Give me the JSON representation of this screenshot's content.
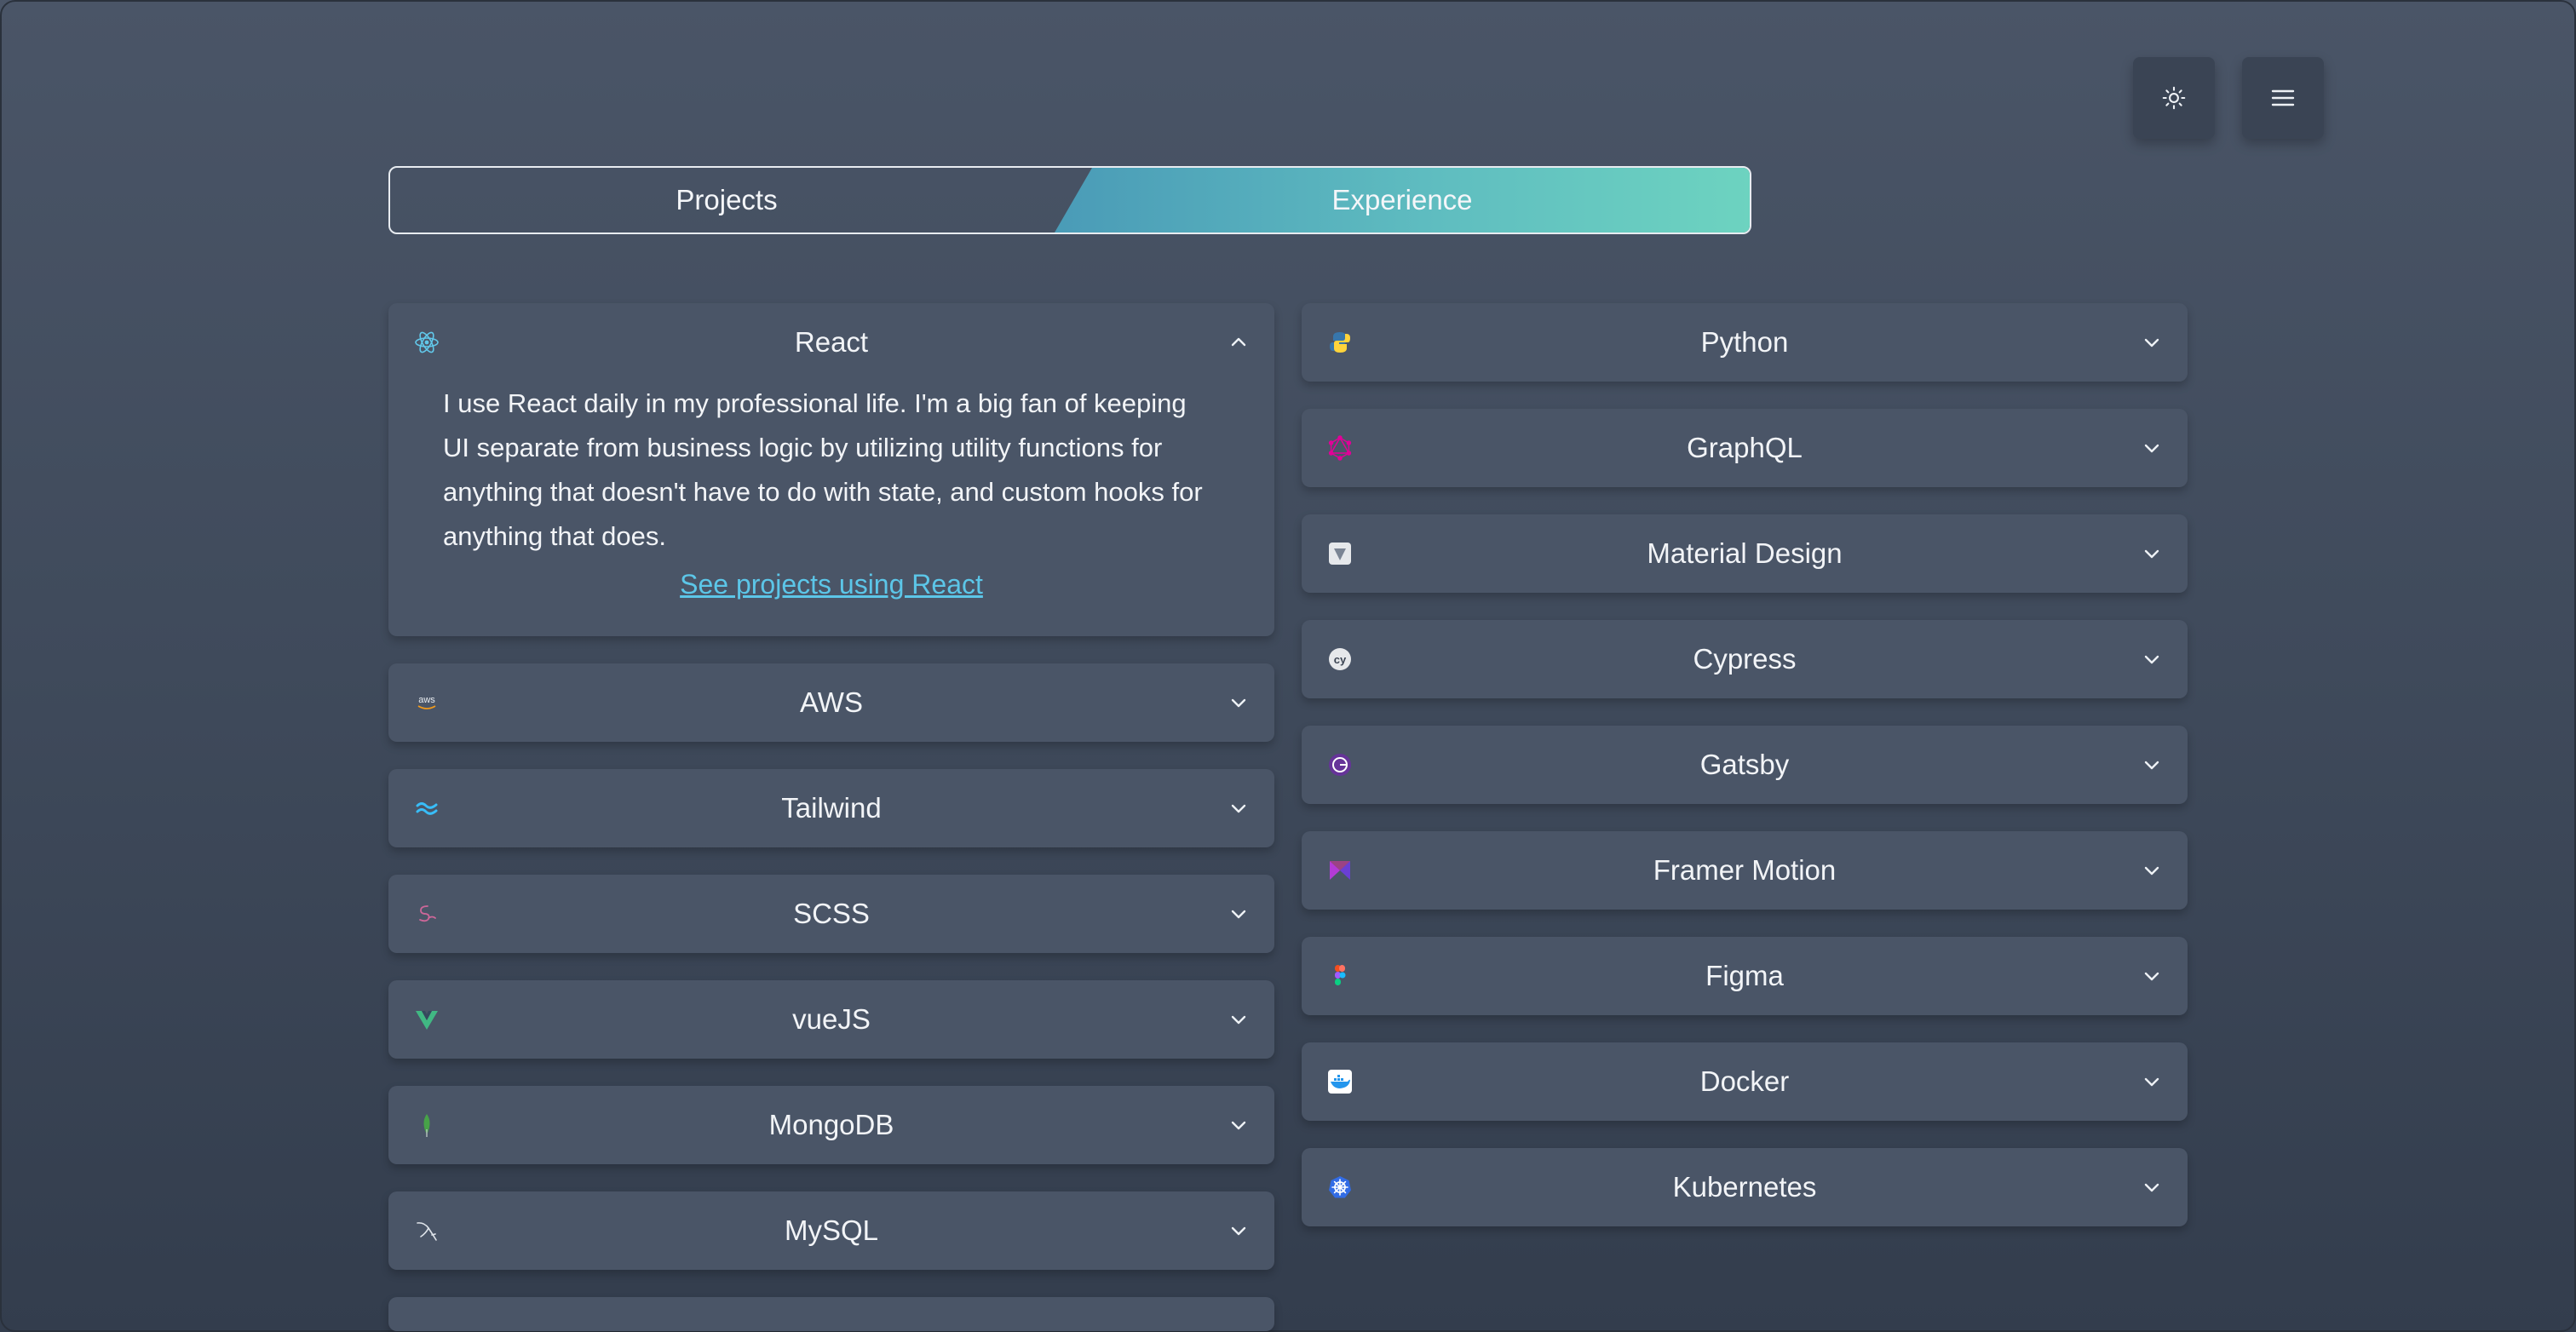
{
  "header": {
    "theme_toggle_icon": "sun-icon",
    "menu_icon": "hamburger-menu-icon"
  },
  "tabs": [
    {
      "label": "Projects",
      "active": false
    },
    {
      "label": "Experience",
      "active": true
    }
  ],
  "left_column": [
    {
      "title": "React",
      "icon": "react-icon",
      "expanded": true,
      "description": "I use React daily in my professional life. I'm a big fan of keeping UI separate from business logic by utilizing utility functions for anything that doesn't have to do with state, and custom hooks for anything that does.",
      "link": "See projects using React"
    },
    {
      "title": "AWS",
      "icon": "aws-icon",
      "expanded": false
    },
    {
      "title": "Tailwind",
      "icon": "tailwind-icon",
      "expanded": false
    },
    {
      "title": "SCSS",
      "icon": "sass-icon",
      "expanded": false
    },
    {
      "title": "vueJS",
      "icon": "vue-icon",
      "expanded": false
    },
    {
      "title": "MongoDB",
      "icon": "mongodb-icon",
      "expanded": false
    },
    {
      "title": "MySQL",
      "icon": "mysql-icon",
      "expanded": false
    }
  ],
  "right_column": [
    {
      "title": "Python",
      "icon": "python-icon",
      "expanded": false
    },
    {
      "title": "GraphQL",
      "icon": "graphql-icon",
      "expanded": false
    },
    {
      "title": "Material Design",
      "icon": "material-design-icon",
      "expanded": false
    },
    {
      "title": "Cypress",
      "icon": "cypress-icon",
      "expanded": false
    },
    {
      "title": "Gatsby",
      "icon": "gatsby-icon",
      "expanded": false
    },
    {
      "title": "Framer Motion",
      "icon": "framer-motion-icon",
      "expanded": false
    },
    {
      "title": "Figma",
      "icon": "figma-icon",
      "expanded": false
    },
    {
      "title": "Docker",
      "icon": "docker-icon",
      "expanded": false
    },
    {
      "title": "Kubernetes",
      "icon": "kubernetes-icon",
      "expanded": false
    }
  ],
  "colors": {
    "accent_link": "#5cc6e8",
    "tab_gradient_start": "#4a9bb7",
    "tab_gradient_end": "#6dd3c0",
    "card_bg": "#4a5567"
  }
}
